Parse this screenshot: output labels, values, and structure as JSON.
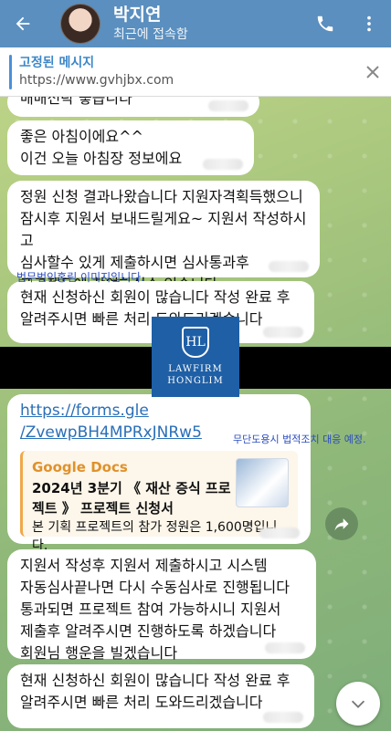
{
  "header": {
    "contact_name": "박지연",
    "status": "최근에 접속함"
  },
  "pinned": {
    "title": "고정된 메시지",
    "body": "https://www.gvhjbx.com"
  },
  "messages": {
    "m0_partial": "매매선탁 좋습니다",
    "m1": "좋은 아침이에요^^\n이건 오늘 아침장 정보에요",
    "m2": "정원 신청 결과나왔습니다 지원자격획득했으니\n잠시후 지원서 보내드릴게요~ 지원서 작성하시고\n심사할수 있게 제출하시면 심사통과후\n프로젝트에 참여하실수 있습니다",
    "m3": "현재 신청하신 회원이 많습니다 작성 완료 후\n알려주시면 빠른 처리 도와드리겠습니다",
    "m4_link": "https://forms.gle\n/ZvewpBH4MPRxJNRw5",
    "m4_preview_source": "Google Docs",
    "m4_preview_title": "2024년 3분기 《 재산 증식 프로젝트 》 프로젝트 신청서",
    "m4_preview_desc": "본 기획 프로젝트의 참가 정원은 1,600명입니다.",
    "m5": "지원서 작성후 지원서 제출하시고 시스템\n자동심사끝나면 다시 수동심사로 진행됩니다\n통과되면 프로젝트 참여 가능하시니 지원서\n제출후 알려주시면 진행하도록 하겠습니다\n회원님 행운을 빌겠습니다",
    "m6": "현재 신청하신 회원이 많습니다 작성 완료 후\n알려주시면 빠른 처리 도와드리겠습니다"
  },
  "watermarks": {
    "top": "법무법인홍림 이미지입니다.",
    "mid": "무단도용시 법적조치 대응 예정.",
    "logo_line1": "LAWFIRM",
    "logo_line2": "HONGLIM",
    "logo_mark": "HL"
  },
  "icons": [
    "back-arrow-icon",
    "phone-icon",
    "more-vert-icon",
    "close-icon",
    "share-icon",
    "chevron-down-icon"
  ],
  "colors": {
    "header": "#5a8fbf",
    "link": "#2a6fb8",
    "pinned_accent": "#4a90d9",
    "preview_accent": "#f0a84a"
  }
}
